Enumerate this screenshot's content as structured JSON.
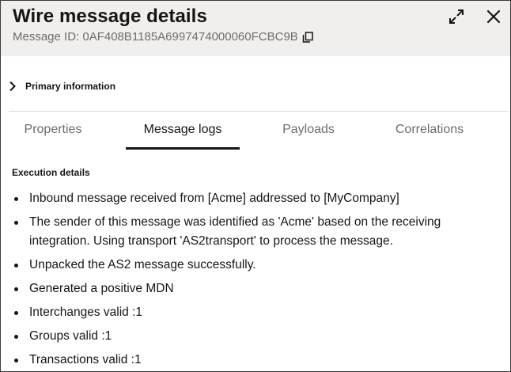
{
  "header": {
    "title": "Wire message details",
    "message_id": "Message ID: 0AF408B1185A6997474000060FCBC9B",
    "icons": {
      "copy": "copy-icon",
      "expand": "expand-icon",
      "close": "close-icon"
    }
  },
  "primary_section": {
    "label": "Primary information",
    "icon": "chevron-right-icon",
    "expanded": false
  },
  "tabs": [
    {
      "label": "Properties",
      "active": false
    },
    {
      "label": "Message logs",
      "active": true
    },
    {
      "label": "Payloads",
      "active": false
    },
    {
      "label": "Correlations",
      "active": false
    }
  ],
  "execution": {
    "title": "Execution details",
    "items": [
      "Inbound message received from [Acme] addressed to [MyCompany]",
      "The sender of this message was identified as 'Acme' based on the receiving integration. Using transport 'AS2transport' to process the message.",
      "Unpacked the AS2 message successfully.",
      "Generated a positive MDN",
      "Interchanges valid :1",
      "Groups valid :1",
      "Transactions valid :1"
    ]
  },
  "colors": {
    "header_bg": "#f1efed",
    "text": "#161513",
    "muted": "#6f6c69",
    "divider": "#dcd9d6"
  }
}
